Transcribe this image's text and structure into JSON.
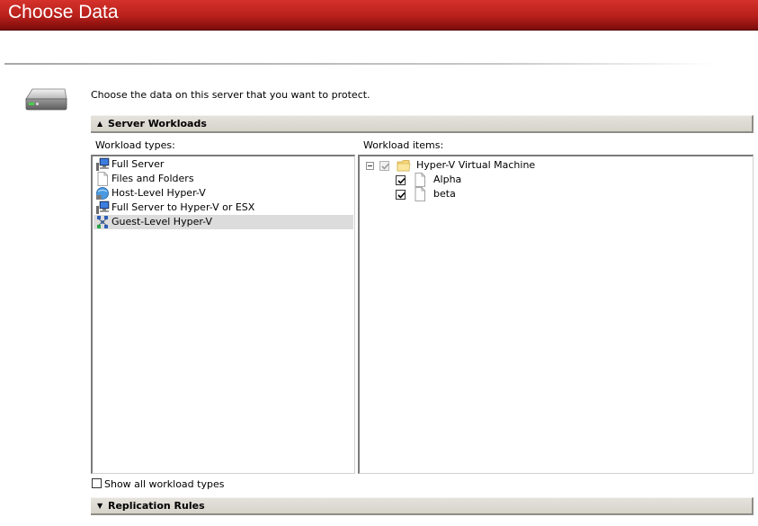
{
  "window": {
    "title": "Choose Data"
  },
  "intro_text": "Choose the data on this server that you want to protect.",
  "sections": {
    "workloads": {
      "label": "Server Workloads",
      "state": "expanded"
    },
    "replication": {
      "label": "Replication Rules",
      "state": "collapsed"
    }
  },
  "workload_types": {
    "label": "Workload types:",
    "items": [
      {
        "label": "Full Server",
        "icon": "server-icon",
        "selected": false
      },
      {
        "label": "Files and Folders",
        "icon": "file-icon",
        "selected": false
      },
      {
        "label": "Host-Level Hyper-V",
        "icon": "hyperv-host-icon",
        "selected": false
      },
      {
        "label": "Full Server to Hyper-V or ESX",
        "icon": "server-icon",
        "selected": false
      },
      {
        "label": "Guest-Level Hyper-V",
        "icon": "hyperv-guest-icon",
        "selected": true
      }
    ]
  },
  "workload_items": {
    "label": "Workload items:",
    "root": {
      "label": "Hyper-V Virtual Machine",
      "expanded": true,
      "checked": true,
      "icon": "folder-icon",
      "children": [
        {
          "label": "Alpha",
          "checked": true,
          "icon": "file-icon"
        },
        {
          "label": "beta",
          "checked": true,
          "icon": "file-icon"
        }
      ]
    }
  },
  "show_all": {
    "label": "Show all workload types",
    "checked": false
  },
  "colors": {
    "title_bar": "#b8201b",
    "selected_row": "#dcdcdc",
    "header_bar": "#d6d3cb"
  }
}
